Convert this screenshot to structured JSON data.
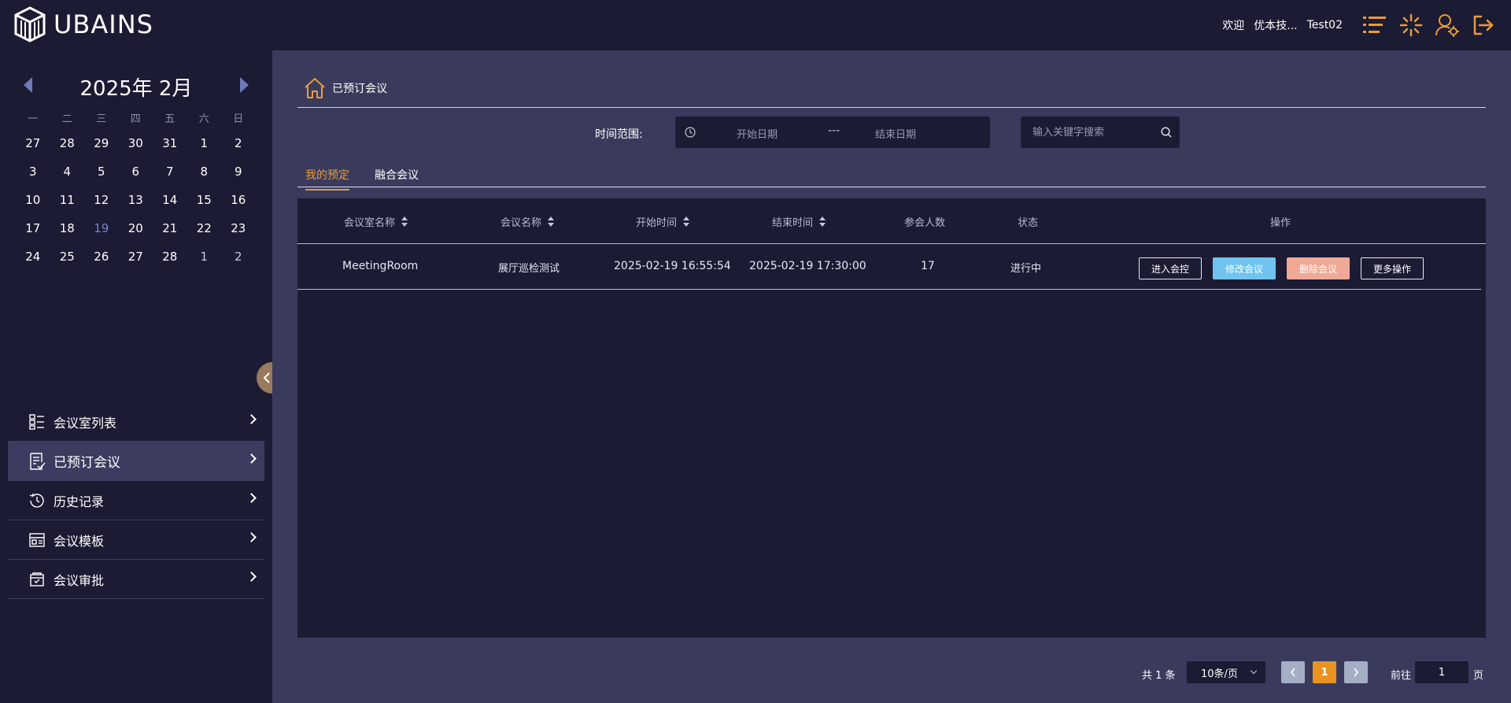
{
  "header": {
    "brand": "UBAINS",
    "welcome": "欢迎",
    "company": "优本技...",
    "username": "Test02",
    "accent": "#e89b3b"
  },
  "calendar": {
    "title": "2025年  2月",
    "weekdays": [
      "一",
      "二",
      "三",
      "四",
      "五",
      "六",
      "日"
    ],
    "weeks": [
      [
        "27",
        "28",
        "29",
        "30",
        "31",
        "1",
        "2"
      ],
      [
        "3",
        "4",
        "5",
        "6",
        "7",
        "8",
        "9"
      ],
      [
        "10",
        "11",
        "12",
        "13",
        "14",
        "15",
        "16"
      ],
      [
        "17",
        "18",
        "19",
        "20",
        "21",
        "22",
        "23"
      ],
      [
        "24",
        "25",
        "26",
        "27",
        "28",
        "1",
        "2"
      ]
    ],
    "today": "19"
  },
  "sidebar": {
    "items": [
      {
        "label": "会议室列表",
        "icon": "list-icon"
      },
      {
        "label": "已预订会议",
        "icon": "booking-icon"
      },
      {
        "label": "历史记录",
        "icon": "history-icon"
      },
      {
        "label": "会议模板",
        "icon": "template-icon"
      },
      {
        "label": "会议审批",
        "icon": "approval-icon"
      }
    ],
    "active_index": 1
  },
  "breadcrumb": {
    "label": "已预订会议"
  },
  "filter": {
    "label": "时间范围:",
    "start_placeholder": "开始日期",
    "separator": "---",
    "end_placeholder": "结束日期",
    "search_placeholder": "输入关键字搜索"
  },
  "tabs": [
    {
      "label": "我的预定",
      "active": true
    },
    {
      "label": "融合会议",
      "active": false
    }
  ],
  "table": {
    "columns": [
      "会议室名称",
      "会议名称",
      "开始时间",
      "结束时间",
      "参会人数",
      "状态",
      "操作"
    ],
    "rows": [
      {
        "room": "MeetingRoom",
        "name": "展厅巡检测试",
        "start": "2025-02-19 16:55:54",
        "end": "2025-02-19 17:30:00",
        "attendees": "17",
        "status": "进行中",
        "actions": [
          "进入会控",
          "修改会议",
          "删除会议",
          "更多操作"
        ]
      }
    ]
  },
  "pagination": {
    "total": "共 1 条",
    "page_size": "10条/页",
    "current": "1",
    "goto_label": "前往",
    "goto_value": "1",
    "goto_unit": "页"
  }
}
